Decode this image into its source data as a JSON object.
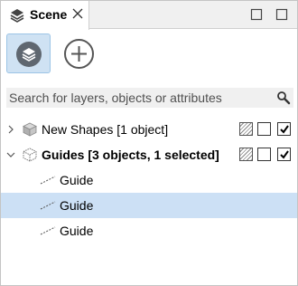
{
  "tab": {
    "title": "Scene",
    "icon": "layers-icon"
  },
  "window_controls": {
    "restore_icon": "restore-icon",
    "maximize_icon": "maximize-icon"
  },
  "toolbar": {
    "layers_icon": "layers-icon",
    "add_icon": "plus-circle-icon"
  },
  "search": {
    "placeholder": "Search for layers, objects or attributes",
    "value": ""
  },
  "tree": [
    {
      "label": "New Shapes [1 object]",
      "expanded": false,
      "bold": false,
      "icon": "cube-icon",
      "locked": false,
      "visible": true
    },
    {
      "label": "Guides [3 objects, 1 selected]",
      "expanded": true,
      "bold": true,
      "icon": "cube-wireframe-icon",
      "locked": false,
      "visible": true,
      "children": [
        {
          "label": "Guide",
          "selected": false
        },
        {
          "label": "Guide",
          "selected": true
        },
        {
          "label": "Guide",
          "selected": false
        }
      ]
    }
  ],
  "colors": {
    "selection": "#cce0f5",
    "active_button": "#cfe2f3"
  }
}
